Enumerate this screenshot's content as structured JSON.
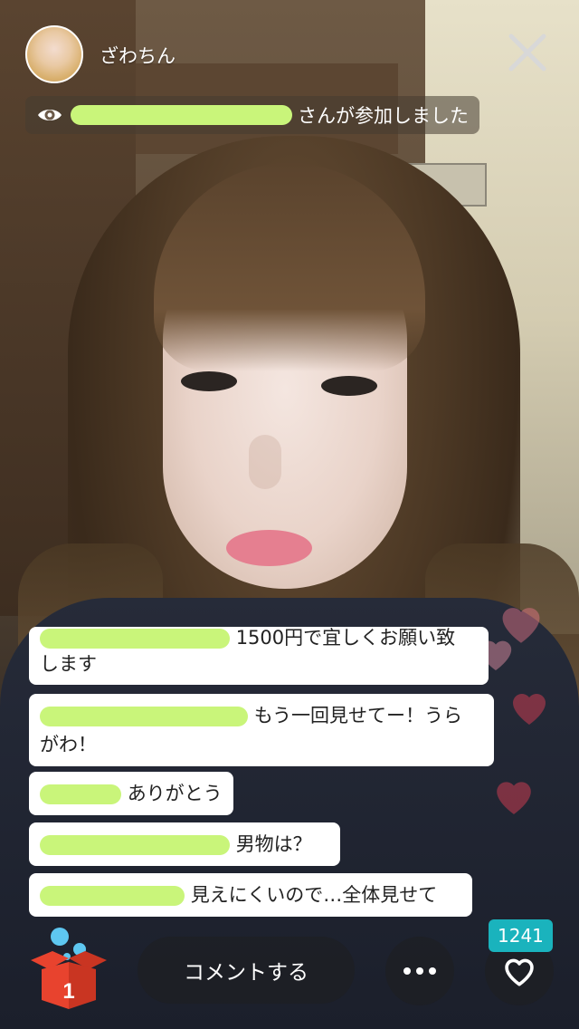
{
  "header": {
    "streamer_name": "ざわちん",
    "join_text": "さんが参加しました"
  },
  "comments": [
    {
      "text_line1": "1500円で宜しくお願い致",
      "text_line2": "します"
    },
    {
      "text_line1": "もう一回見せてー！うら",
      "text_line2": "がわ！"
    },
    {
      "text": "ありがとう"
    },
    {
      "text": "男物は？"
    },
    {
      "text": "見えにくいので…全体見せて"
    }
  ],
  "bottom": {
    "gift_count": "1",
    "comment_button_label": "コメントする",
    "like_count": "1241"
  },
  "colors": {
    "like_badge": "#1ab3bd",
    "gift_red": "#e8432e",
    "gift_blue": "#5ec7f0",
    "redaction": "#c9f57a"
  },
  "icons": {
    "close": "close-icon",
    "eye": "eye-icon",
    "more": "ellipsis-icon",
    "heart": "heart-icon",
    "gift": "gift-box-icon"
  }
}
